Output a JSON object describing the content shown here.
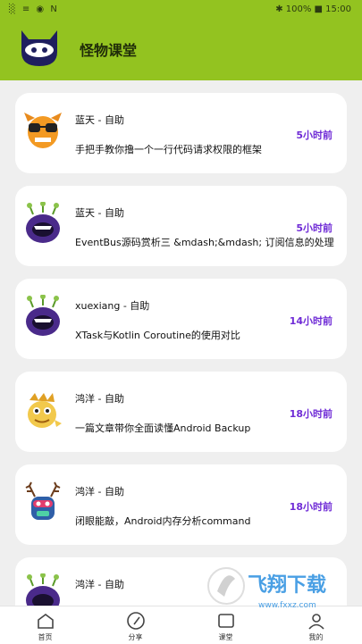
{
  "status_bar": {
    "left": "░ ≡ ◉ N",
    "right": "✱ 100% ■ 15:00"
  },
  "header": {
    "title": "怪物课堂",
    "logo_icon": "monster-logo-icon"
  },
  "cards": [
    {
      "author": "蓝天 - 自助",
      "time": "5小时前",
      "title": "手把手教你撸一个一行代码请求权限的框架",
      "icon": "orange-monster-glasses-icon"
    },
    {
      "author": "蓝天 - 自助",
      "time": "5小时前",
      "title": "EventBus源码赏析三 &mdash;&mdash; 订阅信息的处理",
      "icon": "purple-monster-icon"
    },
    {
      "author": "xuexiang - 自助",
      "time": "14小时前",
      "title": "XTask与Kotlin Coroutine的使用对比",
      "icon": "purple-monster-icon"
    },
    {
      "author": "鸿洋 - 自助",
      "time": "18小时前",
      "title": "一篇文章带你全面读懂Android Backup",
      "icon": "yellow-dragon-icon"
    },
    {
      "author": "鸿洋 - 自助",
      "time": "18小时前",
      "title": "闭眼能敲，Android内存分析command",
      "icon": "antler-monster-icon"
    },
    {
      "author": "鸿洋 - 自助",
      "time": "",
      "title": "",
      "icon": "purple-monster-icon"
    }
  ],
  "tabs": [
    {
      "label": "首页",
      "icon": "home-icon"
    },
    {
      "label": "分享",
      "icon": "compass-icon"
    },
    {
      "label": "课堂",
      "icon": "classroom-icon"
    },
    {
      "label": "我的",
      "icon": "profile-icon"
    }
  ],
  "watermark": {
    "text": "飞翔下载",
    "sub": "www.fxxz.com"
  },
  "colors": {
    "accent": "#93c320",
    "time": "#6f2bd6",
    "background": "#efefef"
  }
}
